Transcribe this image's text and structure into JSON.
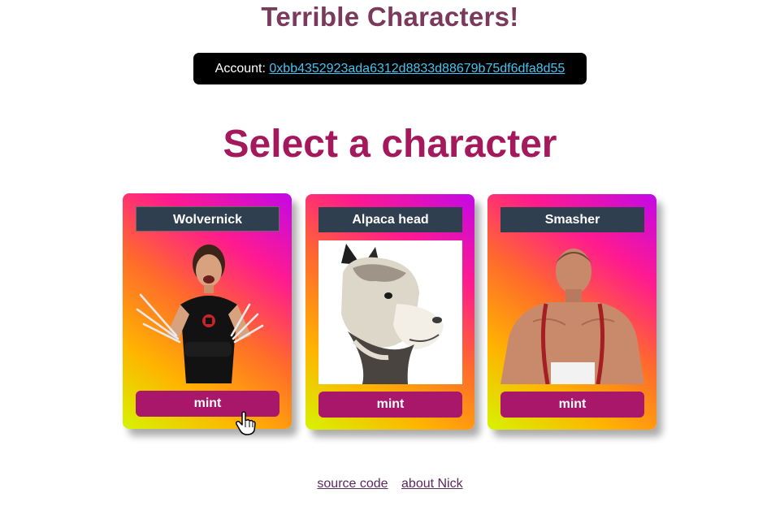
{
  "app": {
    "title": "Terrible Characters!"
  },
  "account": {
    "label": "Account:",
    "address": "0xbb4352923ada6312d8833d88679b75df6dfa8d55"
  },
  "heading": "Select a character",
  "characters": [
    {
      "name": "Wolvernick",
      "action": "mint"
    },
    {
      "name": "Alpaca head",
      "action": "mint"
    },
    {
      "name": "Smasher",
      "action": "mint"
    }
  ],
  "footer": {
    "links": [
      "source code",
      "about Nick"
    ]
  },
  "colors": {
    "title": "#7b3a5c",
    "heading": "#a3195b",
    "mint_button": "#a8176a",
    "name_plate": "#2f3f50",
    "account_link": "#45c3f0"
  }
}
